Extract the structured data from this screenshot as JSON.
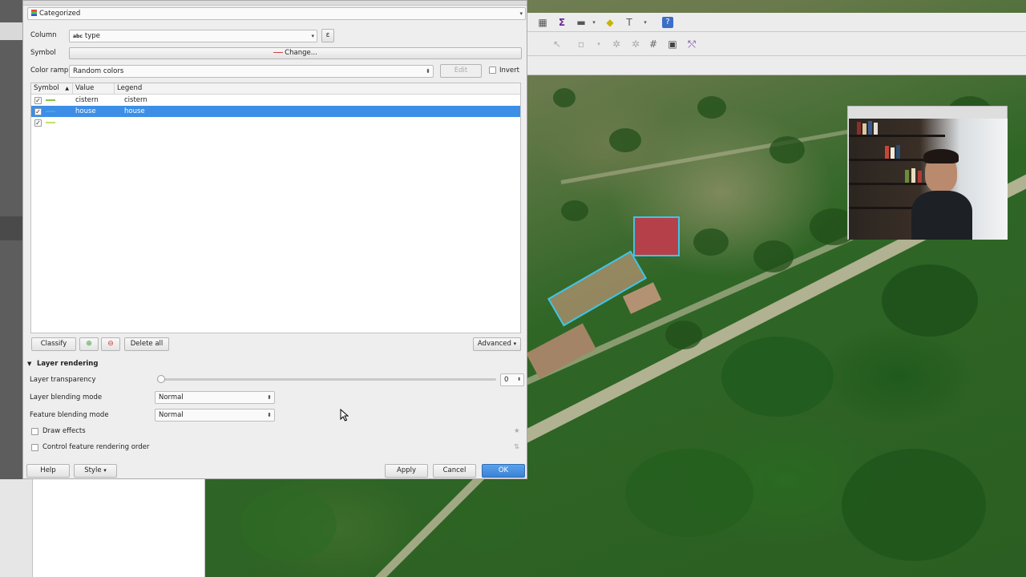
{
  "dialog": {
    "renderer": "Categorized",
    "column_label": "Column",
    "column_value": "type",
    "column_type_badge": "abc",
    "expression_icon": "expression-icon",
    "symbol_label": "Symbol",
    "symbol_change": "Change...",
    "color_ramp_label": "Color ramp",
    "color_ramp_value": "Random colors",
    "edit_label": "Edit",
    "invert_label": "Invert",
    "table": {
      "headers": [
        "Symbol",
        "Value",
        "Legend"
      ],
      "rows": [
        {
          "checked": true,
          "color": "#8bc34a",
          "value": "cistern",
          "legend": "cistern",
          "selected": false
        },
        {
          "checked": true,
          "color": "#4aa3e0",
          "value": "house",
          "legend": "house",
          "selected": true
        },
        {
          "checked": true,
          "color": "#c7dc6a",
          "value": "",
          "legend": "",
          "selected": false
        }
      ]
    },
    "classify_label": "Classify",
    "add_icon": "add-class-icon",
    "remove_icon": "remove-class-icon",
    "delete_all_label": "Delete all",
    "advanced_label": "Advanced",
    "layer_rendering_label": "Layer rendering",
    "layer_transparency_label": "Layer transparency",
    "layer_transparency_value": "0",
    "layer_blending_label": "Layer blending mode",
    "layer_blending_value": "Normal",
    "feature_blending_label": "Feature blending mode",
    "feature_blending_value": "Normal",
    "draw_effects_label": "Draw effects",
    "control_order_label": "Control feature rendering order",
    "help_label": "Help",
    "style_label": "Style",
    "apply_label": "Apply",
    "cancel_label": "Cancel",
    "ok_label": "OK"
  },
  "toolbar": {
    "icons": [
      "measure-icon",
      "sum-icon",
      "ruler-icon",
      "annotation-icon",
      "text-icon",
      "help-icon"
    ]
  },
  "colors": {
    "accent": "#3d8ee6",
    "selection": "#3d8ee6",
    "ok_button": "#4a92e0"
  }
}
